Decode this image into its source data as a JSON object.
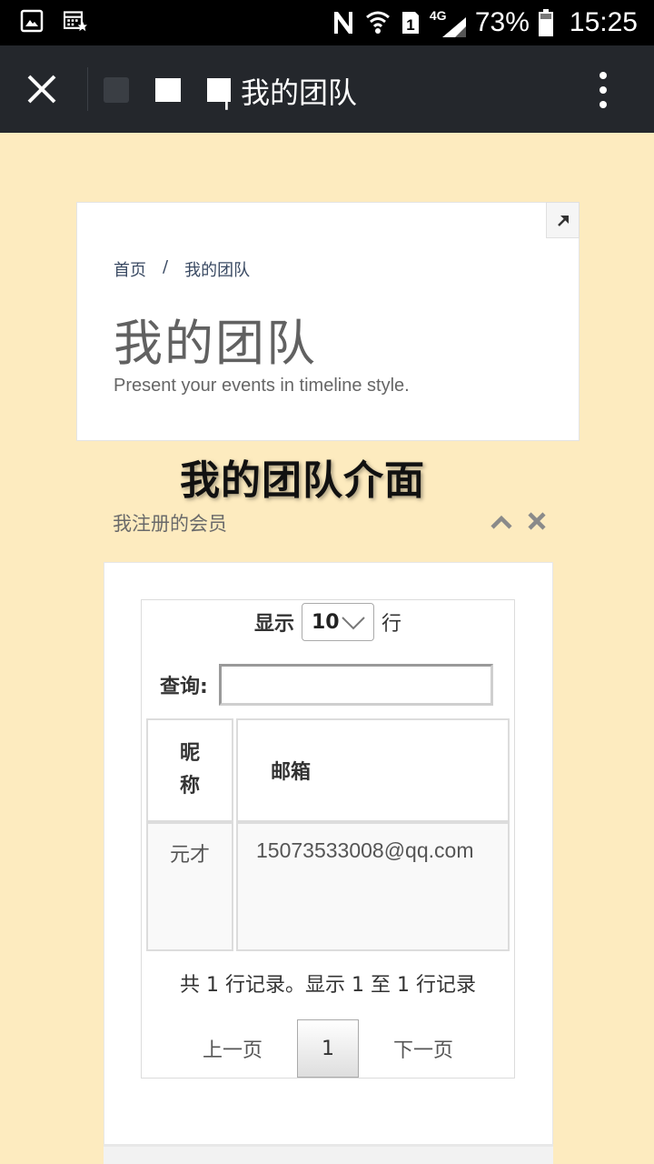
{
  "status_bar": {
    "network": "4G",
    "battery": "73%",
    "time": "15:25"
  },
  "app_bar": {
    "title": "| 我的团队"
  },
  "header": {
    "breadcrumb": [
      "首页",
      "/",
      "我的团队"
    ],
    "title": "我的团队",
    "subtitle": "Present your events in timeline style."
  },
  "overlay_caption": "我的团队介面",
  "section": {
    "title": "我注册的会员"
  },
  "table": {
    "length_prefix": "显示",
    "length_value": "10",
    "length_suffix": "行",
    "search_label": "查询:",
    "search_value": "",
    "columns": [
      "昵称",
      "邮箱"
    ],
    "rows": [
      {
        "nick": "元才",
        "email": "15073533008@qq.com"
      }
    ],
    "info": "共 1 行记录。显示 1 至 1 行记录",
    "pager": {
      "prev": "上一页",
      "current": "1",
      "next": "下一页"
    }
  },
  "icons": {
    "close": "close-icon",
    "menu": "more-vert-icon",
    "expand": "arrow-up-right-icon",
    "collapse": "chevron-up-icon",
    "remove": "close-icon"
  }
}
